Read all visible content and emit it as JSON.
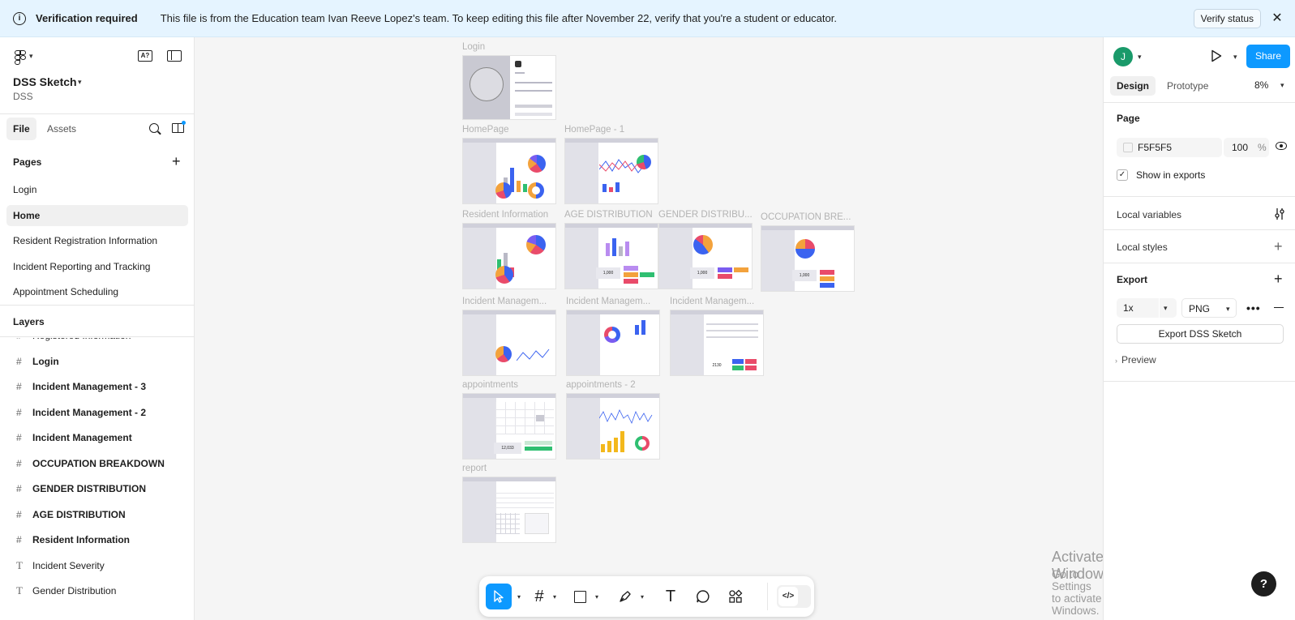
{
  "banner": {
    "title": "Verification required",
    "message": "This file is from the Education team Ivan Reeve Lopez's team. To keep editing this file after November 22, verify that you're a student or educator.",
    "verify_label": "Verify status",
    "close_glyph": "✕"
  },
  "left": {
    "project_name": "DSS Sketch",
    "project_sub": "DSS",
    "ai_label": "A?",
    "tabs": {
      "file": "File",
      "assets": "Assets"
    },
    "pages_heading": "Pages",
    "pages": [
      "Login",
      "Home",
      "Resident Registration Information",
      "Incident Reporting and Tracking",
      "Appointment Scheduling"
    ],
    "active_page": "Home",
    "layers_heading": "Layers",
    "layers_partial": "Registered Information",
    "layers": [
      {
        "label": "Login",
        "type": "frame"
      },
      {
        "label": "Incident Management - 3",
        "type": "frame"
      },
      {
        "label": "Incident Management - 2",
        "type": "frame"
      },
      {
        "label": "Incident Management",
        "type": "frame"
      },
      {
        "label": "OCCUPATION BREAKDOWN",
        "type": "frame"
      },
      {
        "label": "GENDER DISTRIBUTION",
        "type": "frame"
      },
      {
        "label": "AGE DISTRIBUTION",
        "type": "frame"
      },
      {
        "label": "Resident Information",
        "type": "frame"
      },
      {
        "label": "Incident Severity",
        "type": "text"
      },
      {
        "label": "Gender Distribution",
        "type": "text"
      }
    ]
  },
  "canvas": {
    "frames": {
      "login": "Login",
      "homepage": "HomePage",
      "homepage1": "HomePage - 1",
      "resident": "Resident Information",
      "age": "AGE DISTRIBUTION",
      "gender": "GENDER DISTRIBU...",
      "occupation": "OCCUPATION BRE...",
      "im1": "Incident Managem...",
      "im2": "Incident Managem...",
      "im3": "Incident Managem...",
      "appointments": "appointments",
      "appointments2": "appointments - 2",
      "report": "report"
    },
    "thumb_numbers": {
      "age": "1,000",
      "gender": "1,000",
      "occupation": "1,000",
      "im3": "2130",
      "appointments": "12,033"
    },
    "watermark_title": "Activate Windows",
    "watermark_sub": "Go to Settings to activate Windows."
  },
  "toolbar": {
    "tools": [
      "move-tool",
      "frame-tool",
      "shape-tool",
      "pen-tool",
      "text-tool",
      "comment-tool",
      "actions-tool"
    ],
    "dev_mode_glyph": "</>"
  },
  "right": {
    "avatar_initial": "J",
    "share_label": "Share",
    "tabs": {
      "design": "Design",
      "prototype": "Prototype"
    },
    "zoom": "8%",
    "page_heading": "Page",
    "page_color": "F5F5F5",
    "page_opacity": "100",
    "opacity_unit": "%",
    "show_in_exports": "Show in exports",
    "local_variables": "Local variables",
    "local_styles": "Local styles",
    "export_heading": "Export",
    "export_scale": "1x",
    "export_format": "PNG",
    "export_button": "Export DSS Sketch",
    "preview_label": "Preview",
    "help_glyph": "?"
  },
  "colors": {
    "accent": "#0d99ff",
    "banner_bg": "#e5f4ff",
    "canvas_bg": "#f5f5f5",
    "avatar": "#1a9a6a"
  }
}
